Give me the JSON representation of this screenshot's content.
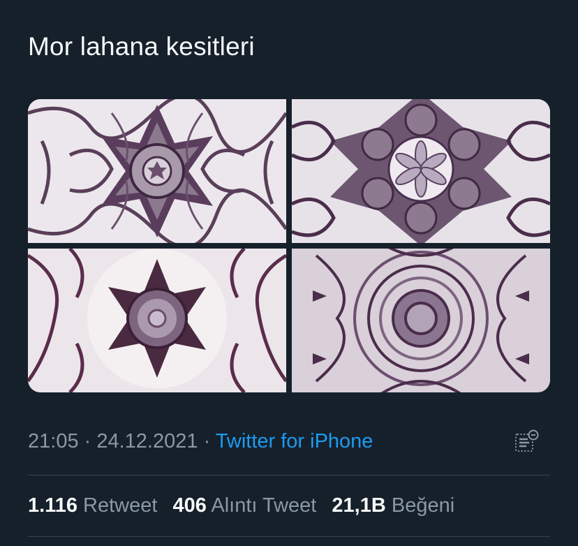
{
  "tweet": {
    "text": "Mor lahana kesitleri",
    "media": [
      {
        "icon": "kaleidoscope-image-1"
      },
      {
        "icon": "kaleidoscope-image-2"
      },
      {
        "icon": "kaleidoscope-image-3"
      },
      {
        "icon": "kaleidoscope-image-4"
      }
    ],
    "time": "21:05",
    "separator": " · ",
    "date": "24.12.2021",
    "source": "Twitter for iPhone"
  },
  "stats": {
    "retweets_count": "1.116",
    "retweets_label": "Retweet",
    "quotes_count": "406",
    "quotes_label": "Alıntı Tweet",
    "likes_count": "21,1B",
    "likes_label": "Beğeni"
  },
  "colors": {
    "background": "#15202b",
    "text": "#f7f9f9",
    "muted": "#8b98a5",
    "link": "#1d9bf0",
    "divider": "#38444d"
  }
}
